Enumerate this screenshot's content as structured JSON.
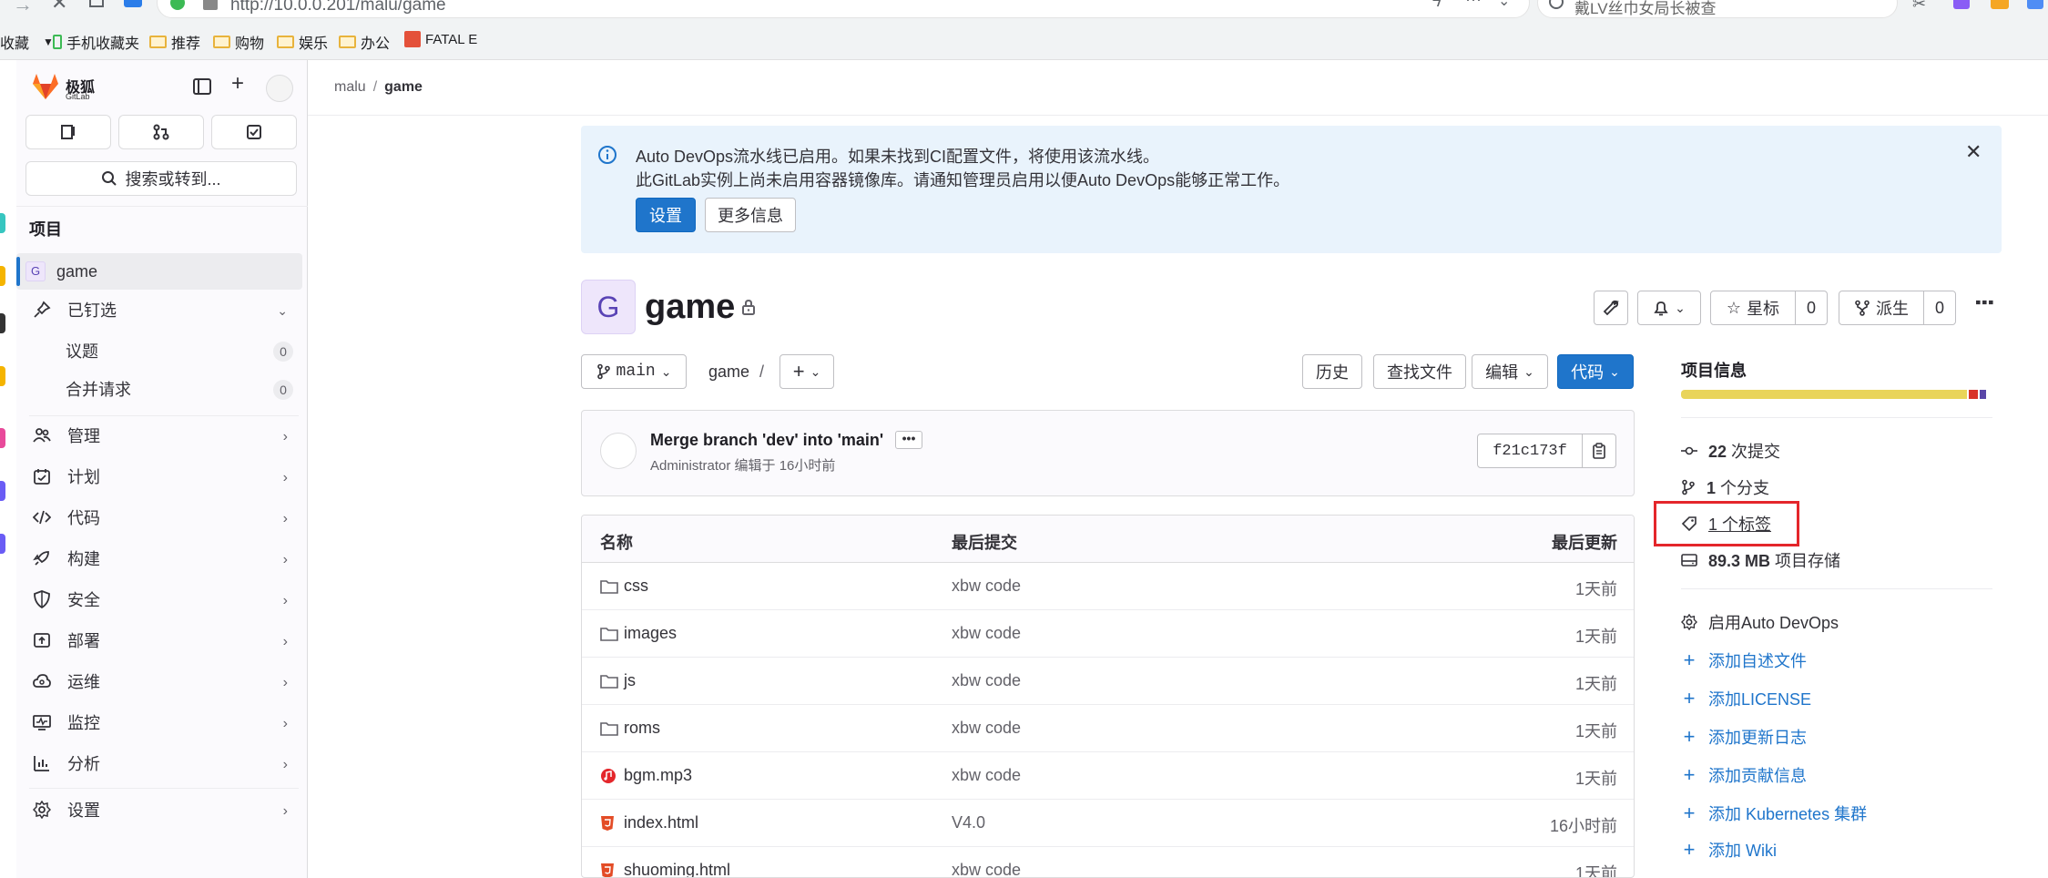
{
  "browser": {
    "url": "http://10.0.0.201/malu/game",
    "search_placeholder": "戴LV丝巾女局长被查",
    "bookmarks": [
      {
        "label": "收藏"
      },
      {
        "label": "手机收藏夹"
      },
      {
        "label": "推荐"
      },
      {
        "label": "购物"
      },
      {
        "label": "娱乐"
      },
      {
        "label": "办公"
      },
      {
        "label": "FATAL E"
      }
    ]
  },
  "sidebar": {
    "logo_text": "极狐",
    "logo_subtext": "GitLab",
    "search_label": "搜索或转到...",
    "section_title": "项目",
    "project_item": {
      "avatar": "G",
      "label": "game"
    },
    "pinned_label": "已钉选",
    "pinned": [
      {
        "label": "议题",
        "count": "0"
      },
      {
        "label": "合并请求",
        "count": "0"
      }
    ],
    "nav": [
      {
        "label": "管理"
      },
      {
        "label": "计划"
      },
      {
        "label": "代码"
      },
      {
        "label": "构建"
      },
      {
        "label": "安全"
      },
      {
        "label": "部署"
      },
      {
        "label": "运维"
      },
      {
        "label": "监控"
      },
      {
        "label": "分析"
      },
      {
        "label": "设置"
      }
    ]
  },
  "breadcrumb": {
    "group": "malu",
    "separator": "/",
    "project": "game"
  },
  "alert": {
    "line1": "Auto DevOps流水线已启用。如果未找到CI配置文件，将使用该流水线。",
    "line2": "此GitLab实例上尚未启用容器镜像库。请通知管理员启用以便Auto DevOps能够正常工作。",
    "primary_button": "设置",
    "secondary_button": "更多信息"
  },
  "project": {
    "avatar": "G",
    "name": "game",
    "star_label": "星标",
    "star_count": "0",
    "fork_label": "派生",
    "fork_count": "0"
  },
  "repo_toolbar": {
    "branch": "main",
    "path": "game",
    "path_sep": "/",
    "history": "历史",
    "find_file": "查找文件",
    "edit": "编辑",
    "code": "代码"
  },
  "last_commit": {
    "title": "Merge branch 'dev' into 'main'",
    "author": "Administrator",
    "meta": "编辑于 16小时前",
    "sha": "f21c173f"
  },
  "file_table": {
    "headers": {
      "name": "名称",
      "commit": "最后提交",
      "updated": "最后更新"
    },
    "rows": [
      {
        "name": "css",
        "type": "folder",
        "commit": "xbw code",
        "updated": "1天前"
      },
      {
        "name": "images",
        "type": "folder",
        "commit": "xbw code",
        "updated": "1天前"
      },
      {
        "name": "js",
        "type": "folder",
        "commit": "xbw code",
        "updated": "1天前"
      },
      {
        "name": "roms",
        "type": "folder",
        "commit": "xbw code",
        "updated": "1天前"
      },
      {
        "name": "bgm.mp3",
        "type": "audio",
        "commit": "xbw code",
        "updated": "1天前"
      },
      {
        "name": "index.html",
        "type": "html",
        "commit": "V4.0",
        "updated": "16小时前"
      },
      {
        "name": "shuoming.html",
        "type": "html",
        "commit": "xbw code",
        "updated": "1天前"
      }
    ]
  },
  "project_info": {
    "title": "项目信息",
    "storage_segments": [
      {
        "color": "#e9d45a",
        "share": 0.93
      },
      {
        "color": "#d8332a",
        "share": 0.03
      },
      {
        "color": "#5a47a8",
        "share": 0.02
      }
    ],
    "commits_value": "22",
    "commits_label": "次提交",
    "branches_value": "1",
    "branches_label": "个分支",
    "tags_label": "1 个标签",
    "storage_value": "89.3 MB",
    "storage_label": "项目存储",
    "enable_autodevops": "启用Auto DevOps",
    "actions": [
      {
        "label": "添加自述文件"
      },
      {
        "label": "添加LICENSE"
      },
      {
        "label": "添加更新日志"
      },
      {
        "label": "添加贡献信息"
      },
      {
        "label": "添加 Kubernetes 集群"
      },
      {
        "label": "添加 Wiki"
      }
    ]
  }
}
